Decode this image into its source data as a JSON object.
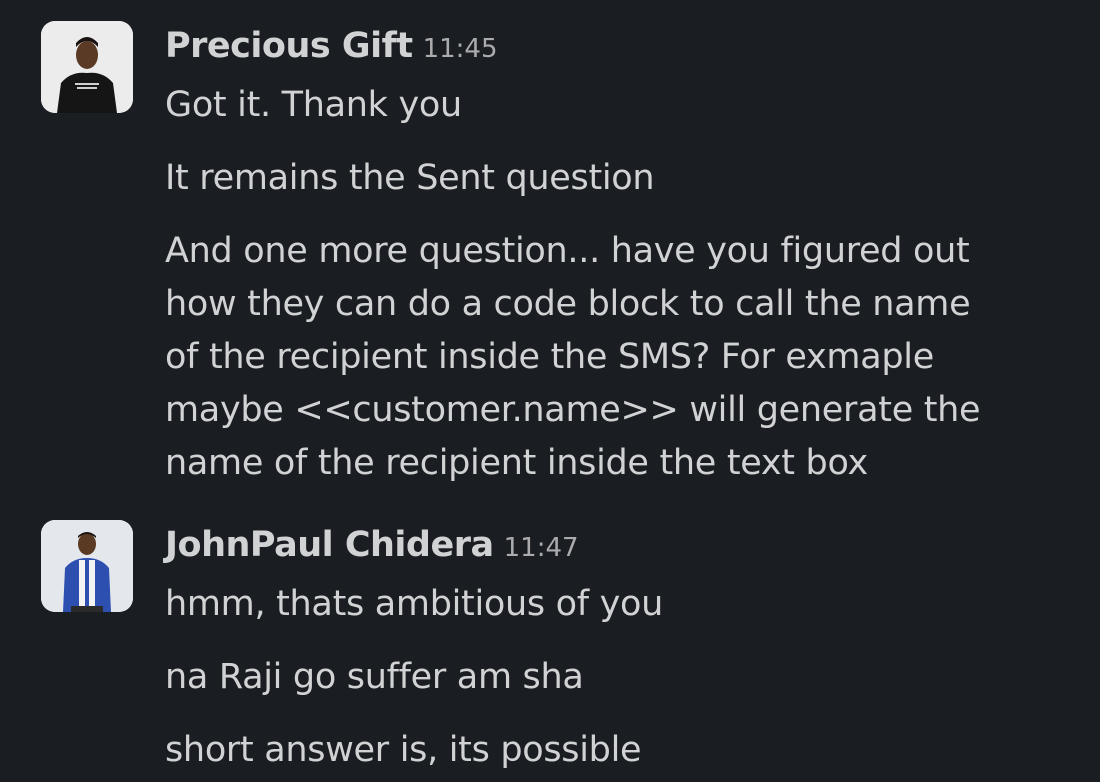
{
  "messages": [
    {
      "author": "Precious Gift",
      "time": "11:45",
      "lines": [
        "Got it. Thank you",
        "It remains the Sent question",
        "And one more question... have you figured out\nhow they can do a code block to call the name\nof the recipient inside the SMS? For exmaple\nmaybe <<customer.name>> will generate the\nname of the recipient inside the text box"
      ]
    },
    {
      "author": "JohnPaul Chidera",
      "time": "11:47",
      "lines": [
        "hmm, thats ambitious of you",
        "na Raji go suffer am sha",
        "short answer is, its possible"
      ]
    }
  ],
  "icons": {
    "avatar_1": "user-avatar-photo",
    "avatar_2": "user-avatar-photo"
  }
}
